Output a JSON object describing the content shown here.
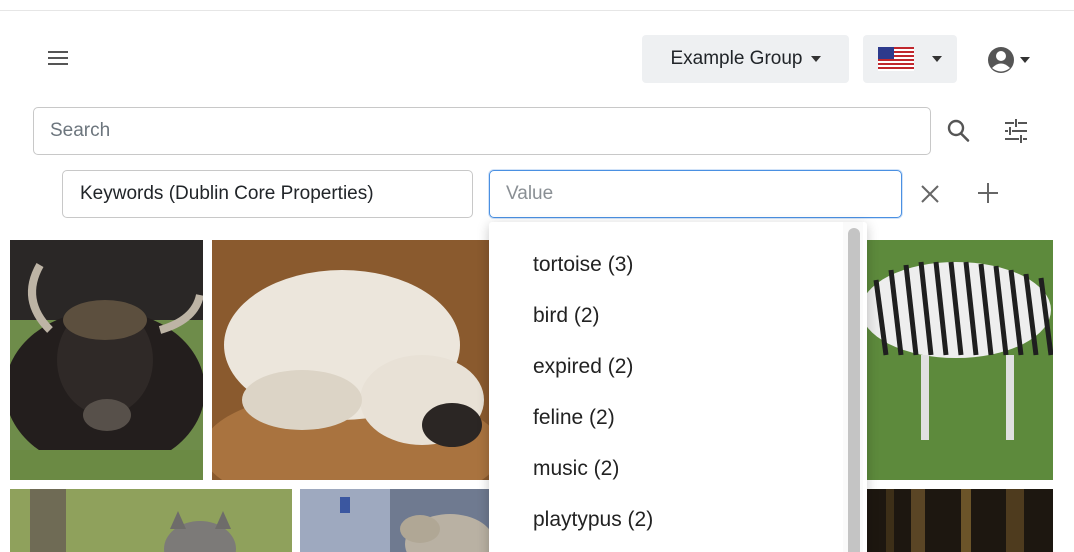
{
  "header": {
    "group_label": "Example Group",
    "language_flag": "us-flag",
    "menu_icon": "hamburger-menu-icon",
    "user_icon": "user-circle-icon"
  },
  "search": {
    "placeholder": "Search",
    "value": ""
  },
  "filter": {
    "field_label": "Keywords (Dublin Core Properties)",
    "value_placeholder": "Value",
    "value": ""
  },
  "suggestions": [
    {
      "label": "tortoise (3)"
    },
    {
      "label": "bird (2)"
    },
    {
      "label": "expired (2)"
    },
    {
      "label": "feline (2)"
    },
    {
      "label": "music (2)"
    },
    {
      "label": "playtypus (2)"
    }
  ],
  "colors": {
    "accent": "#4a90e2",
    "button_bg": "#eef0f2",
    "border": "#c8c8c8"
  }
}
